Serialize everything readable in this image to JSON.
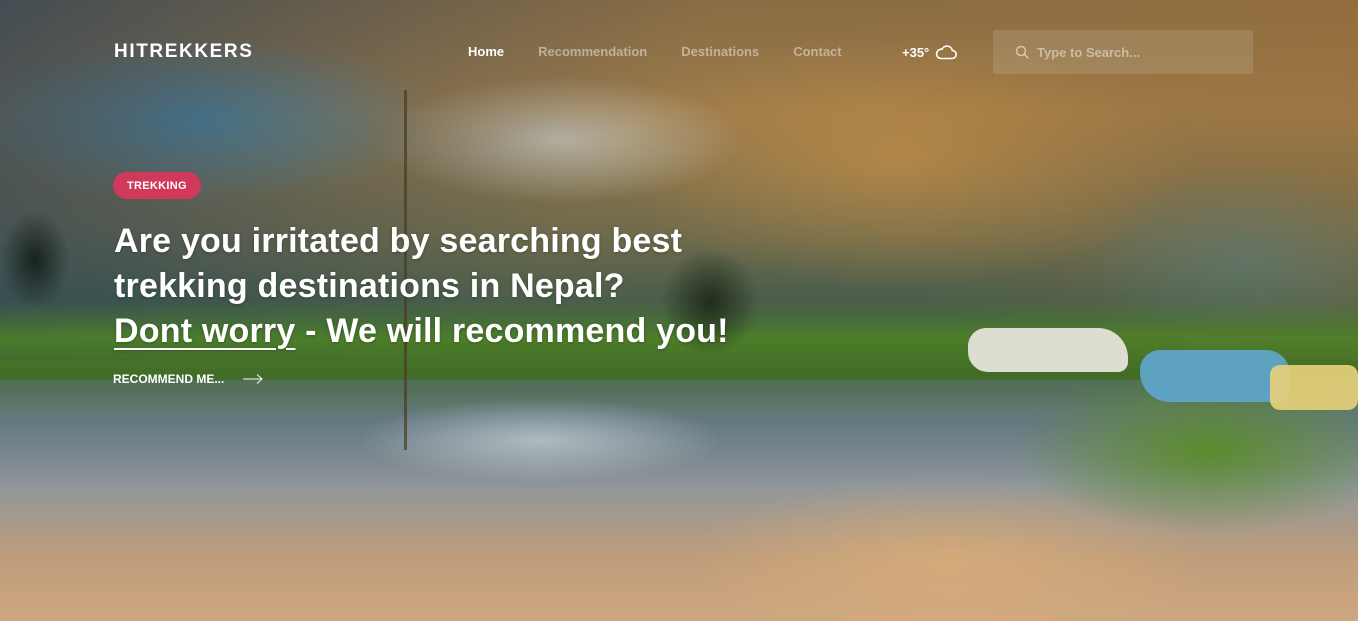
{
  "nav": {
    "brand": "HITREKKERS",
    "links": [
      {
        "label": "Home",
        "active": true
      },
      {
        "label": "Recommendation",
        "active": false
      },
      {
        "label": "Destinations",
        "active": false
      },
      {
        "label": "Contact",
        "active": false
      }
    ],
    "weather": {
      "temperature": "+35°",
      "icon": "cloud-icon"
    },
    "search": {
      "placeholder": "Type to Search...",
      "value": "",
      "icon": "search-icon"
    }
  },
  "hero": {
    "badge": "TREKKING",
    "headline": {
      "line1": "Are you irritated by searching best",
      "line2": "trekking destinations in Nepal?",
      "line3_underlined": "Dont worry",
      "line3_rest": " - We will recommend you!"
    },
    "cta": {
      "label": "RECOMMEND ME...",
      "icon": "arrow-right-icon"
    }
  },
  "colors": {
    "badge_bg": "#d1395a",
    "text": "#ffffff",
    "inactive_nav": "rgba(255,255,255,0.45)"
  }
}
